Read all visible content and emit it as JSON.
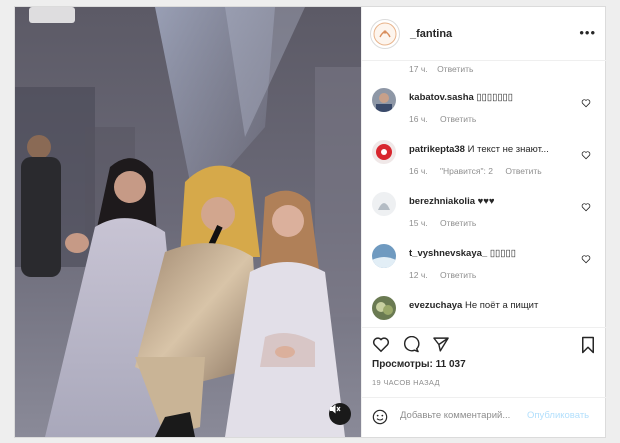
{
  "post": {
    "username": "_fantina",
    "more_label": "•••"
  },
  "top_meta": {
    "time": "17 ч.",
    "reply": "Ответить"
  },
  "comments": [
    {
      "user": "kabatov.sasha",
      "text": "▯▯▯▯▯▯▯",
      "time": "16 ч.",
      "likes": "",
      "reply": "Ответить"
    },
    {
      "user": "patrikepta38",
      "text": "И текст не знают...",
      "time": "16 ч.",
      "likes": "\"Нравится\": 2",
      "reply": "Ответить"
    },
    {
      "user": "berezhniakolia",
      "text": "♥♥♥",
      "time": "15 ч.",
      "likes": "",
      "reply": "Ответить"
    },
    {
      "user": "t_vyshnevskaya_",
      "text": "▯▯▯▯▯",
      "time": "12 ч.",
      "likes": "",
      "reply": "Ответить"
    },
    {
      "user": "evezuchaya",
      "text": "Не поёт а пищит",
      "time": "",
      "likes": "",
      "reply": ""
    }
  ],
  "stats": {
    "views_label": "Просмотры: 11 037",
    "time_ago": "19 ЧАСОВ НАЗАД"
  },
  "add_comment": {
    "placeholder": "Добавьте комментарий...",
    "publish_label": "Опубликовать"
  },
  "icons": {
    "like": "heart-icon",
    "comment": "comment-icon",
    "share": "share-icon",
    "save": "bookmark-icon",
    "mute": "speaker-muted-icon",
    "emoji": "emoji-icon"
  },
  "colors": {
    "link_disabled": "#b2dffc",
    "muted_text": "#8e8e8e",
    "text": "#262626"
  }
}
